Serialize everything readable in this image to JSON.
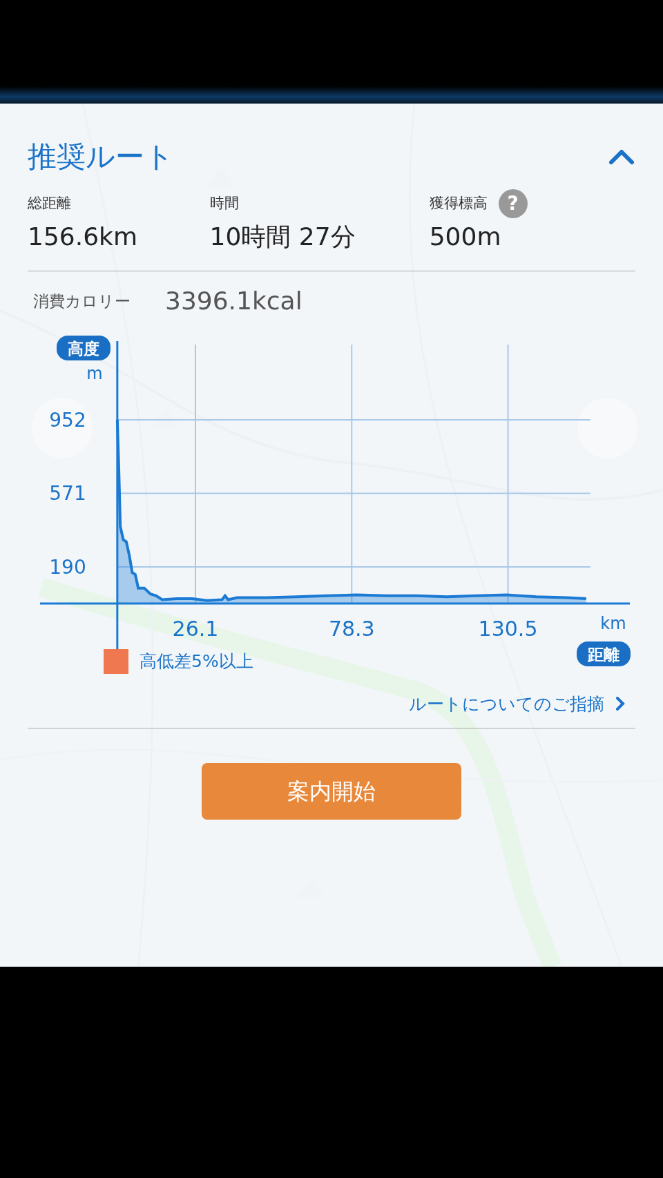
{
  "route_panel": {
    "title": "推奨ルート",
    "expanded": true,
    "stats": [
      {
        "label": "総距離",
        "value": "156.6km"
      },
      {
        "label": "時間",
        "value": "10時間 27分"
      },
      {
        "label": "獲得標高",
        "value": "500m",
        "help": "?"
      }
    ],
    "calories": {
      "label": "消費カロリー",
      "value": "3396.1kcal"
    },
    "elevation_chart": {
      "y_unit": "m",
      "x_unit": "km",
      "chart_data": {
        "type": "area",
        "xlabel": "距離",
        "ylabel": "高度",
        "x": [
          0,
          0.5,
          1,
          2,
          3,
          4,
          5,
          6,
          7,
          9,
          11,
          13,
          15,
          20,
          25,
          30,
          35,
          36,
          37,
          40,
          50,
          60,
          70,
          80,
          90,
          100,
          110,
          120,
          130,
          140,
          150,
          156.6
        ],
        "series": [
          {
            "color": "#1a7ad4",
            "values": [
              952,
              700,
              400,
              330,
              320,
              250,
              160,
              150,
              80,
              80,
              50,
              40,
              20,
              25,
              25,
              15,
              20,
              40,
              20,
              30,
              30,
              35,
              40,
              45,
              40,
              40,
              35,
              40,
              45,
              35,
              30,
              25
            ]
          }
        ],
        "xlim": [
          -25.8,
          171.2
        ],
        "ylim": [
          0,
          1360
        ],
        "grid": true,
        "xticks": [
          26.1,
          78.3,
          130.5
        ],
        "yticks": [
          190,
          571,
          952
        ]
      }
    },
    "legend": [
      {
        "label": "高低差5%以上",
        "color": "#f07850"
      }
    ],
    "feedback_link": "ルートについてのご指摘",
    "start_button": "案内開始"
  }
}
